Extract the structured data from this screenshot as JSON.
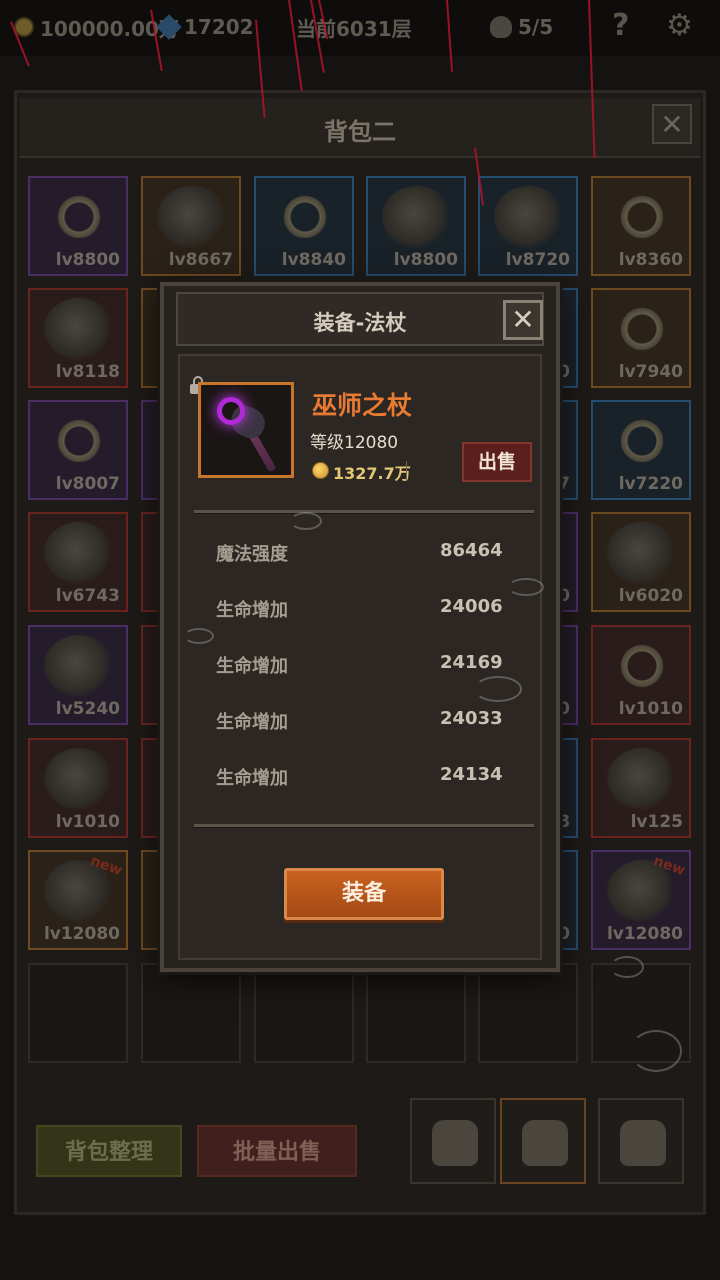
{
  "topbar": {
    "gold": "100000.00万",
    "gems": "17202",
    "floor": "当前6031层",
    "kills": "5/5",
    "help": "?",
    "settings": "⚙"
  },
  "bag": {
    "title": "背包二",
    "close": "✕",
    "slots": [
      {
        "lv": "lv8800"
      },
      {
        "lv": "lv8667"
      },
      {
        "lv": "lv8840"
      },
      {
        "lv": "lv8800"
      },
      {
        "lv": "lv8720"
      },
      {
        "lv": "lv8360"
      },
      {
        "lv": "lv8118"
      },
      {
        "lv": "lv7940",
        "prefix": "00"
      },
      {
        "lv": "lv8007"
      },
      {
        "lv": "lv7220",
        "prefix": "47"
      },
      {
        "lv": "lv6743"
      },
      {
        "lv": "lv6020",
        "prefix": "80"
      },
      {
        "lv": "lv5240"
      },
      {
        "lv": "lv1010",
        "prefix": "10"
      },
      {
        "lv": "lv1010"
      },
      {
        "lv": "lv125",
        "prefix": "08"
      },
      {
        "lv": "lv12080",
        "new": "new"
      },
      {
        "lv": "lv12080",
        "prefix": "080",
        "new": "new"
      }
    ],
    "sort_label": "背包整理",
    "bulk_sell_label": "批量出售"
  },
  "modal": {
    "title": "装备-法杖",
    "close": "✕",
    "item": {
      "name": "巫师之杖",
      "level": "等级12080",
      "price": "1327.7万",
      "sell_label": "出售"
    },
    "stats": [
      {
        "name": "魔法强度",
        "value": "86464"
      },
      {
        "name": "生命增加",
        "value": "24006"
      },
      {
        "name": "生命增加",
        "value": "24169"
      },
      {
        "name": "生命增加",
        "value": "24033"
      },
      {
        "name": "生命增加",
        "value": "24134"
      }
    ],
    "equip_label": "装备"
  },
  "colors": {
    "accent": "#e87a33",
    "sell": "#5b1f1c",
    "equip": "#c8611f",
    "rain": "#b0142a"
  }
}
